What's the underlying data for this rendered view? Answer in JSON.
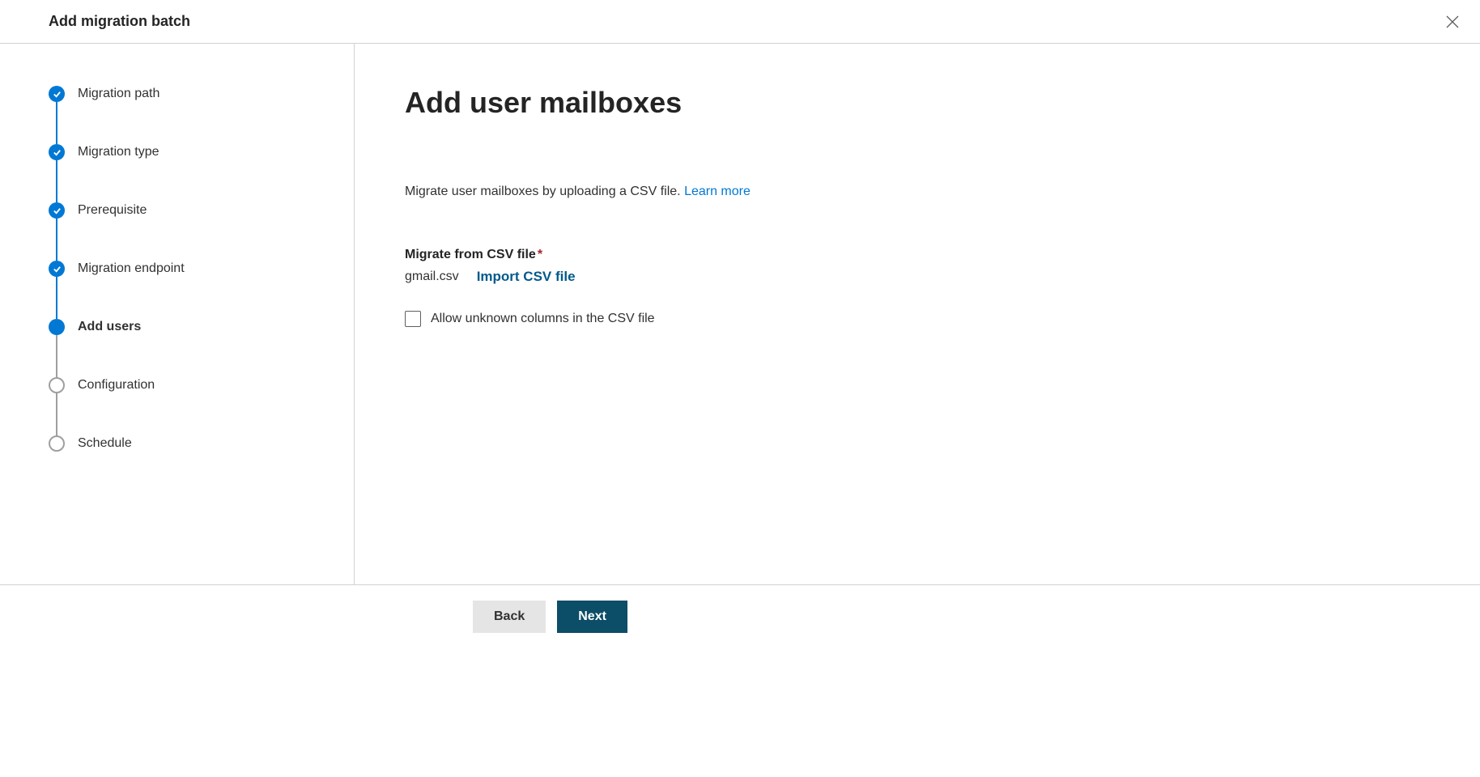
{
  "header": {
    "title": "Add migration batch"
  },
  "steps": [
    {
      "label": "Migration path",
      "state": "done"
    },
    {
      "label": "Migration type",
      "state": "done"
    },
    {
      "label": "Prerequisite",
      "state": "done"
    },
    {
      "label": "Migration endpoint",
      "state": "done"
    },
    {
      "label": "Add users",
      "state": "current"
    },
    {
      "label": "Configuration",
      "state": "pending"
    },
    {
      "label": "Schedule",
      "state": "pending"
    }
  ],
  "main": {
    "heading": "Add user mailboxes",
    "description_prefix": "Migrate user mailboxes by uploading a CSV file. ",
    "learn_more": "Learn more",
    "field_label": "Migrate from CSV file",
    "file_name": "gmail.csv",
    "import_link": "Import CSV file",
    "checkbox_label": "Allow unknown columns in the CSV file"
  },
  "footer": {
    "back": "Back",
    "next": "Next"
  }
}
